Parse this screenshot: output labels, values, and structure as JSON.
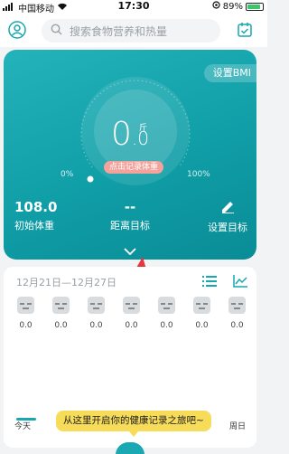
{
  "status_bar": {
    "carrier": "中国移动",
    "time": "17:30",
    "battery": "89%"
  },
  "search": {
    "placeholder": "搜索食物营养和热量"
  },
  "card": {
    "bmi_button": "设置BMI",
    "weight_int": "0",
    "weight_dec": ".0",
    "unit": "斤",
    "record_button": "点击记录体重",
    "progress_min": "0%",
    "progress_max": "100%",
    "progress": 0,
    "initial_weight": {
      "value": "108.0",
      "label": "初始体重"
    },
    "distance_goal": {
      "value": "--",
      "label": "距离目标"
    },
    "set_goal": {
      "label": "设置目标"
    }
  },
  "week": {
    "range": "12月21日—12月27日",
    "values": [
      "0.0",
      "0.0",
      "0.0",
      "0.0",
      "0.0",
      "0.0",
      "0.0"
    ],
    "today_label": "今天",
    "sunday_label": "周日"
  },
  "tooltip": {
    "text": "从这里开启你的健康记录之旅吧~"
  },
  "colors": {
    "accent": "#17a7b0",
    "pill": "#f3a39b",
    "tooltip": "#f7dc5a",
    "arrow": "#e5373d"
  },
  "icons": [
    "signal-icon",
    "wifi-icon",
    "user-icon",
    "search-icon",
    "calendar-check-icon",
    "edit-icon",
    "chevron-down-icon",
    "list-icon",
    "line-chart-icon"
  ]
}
